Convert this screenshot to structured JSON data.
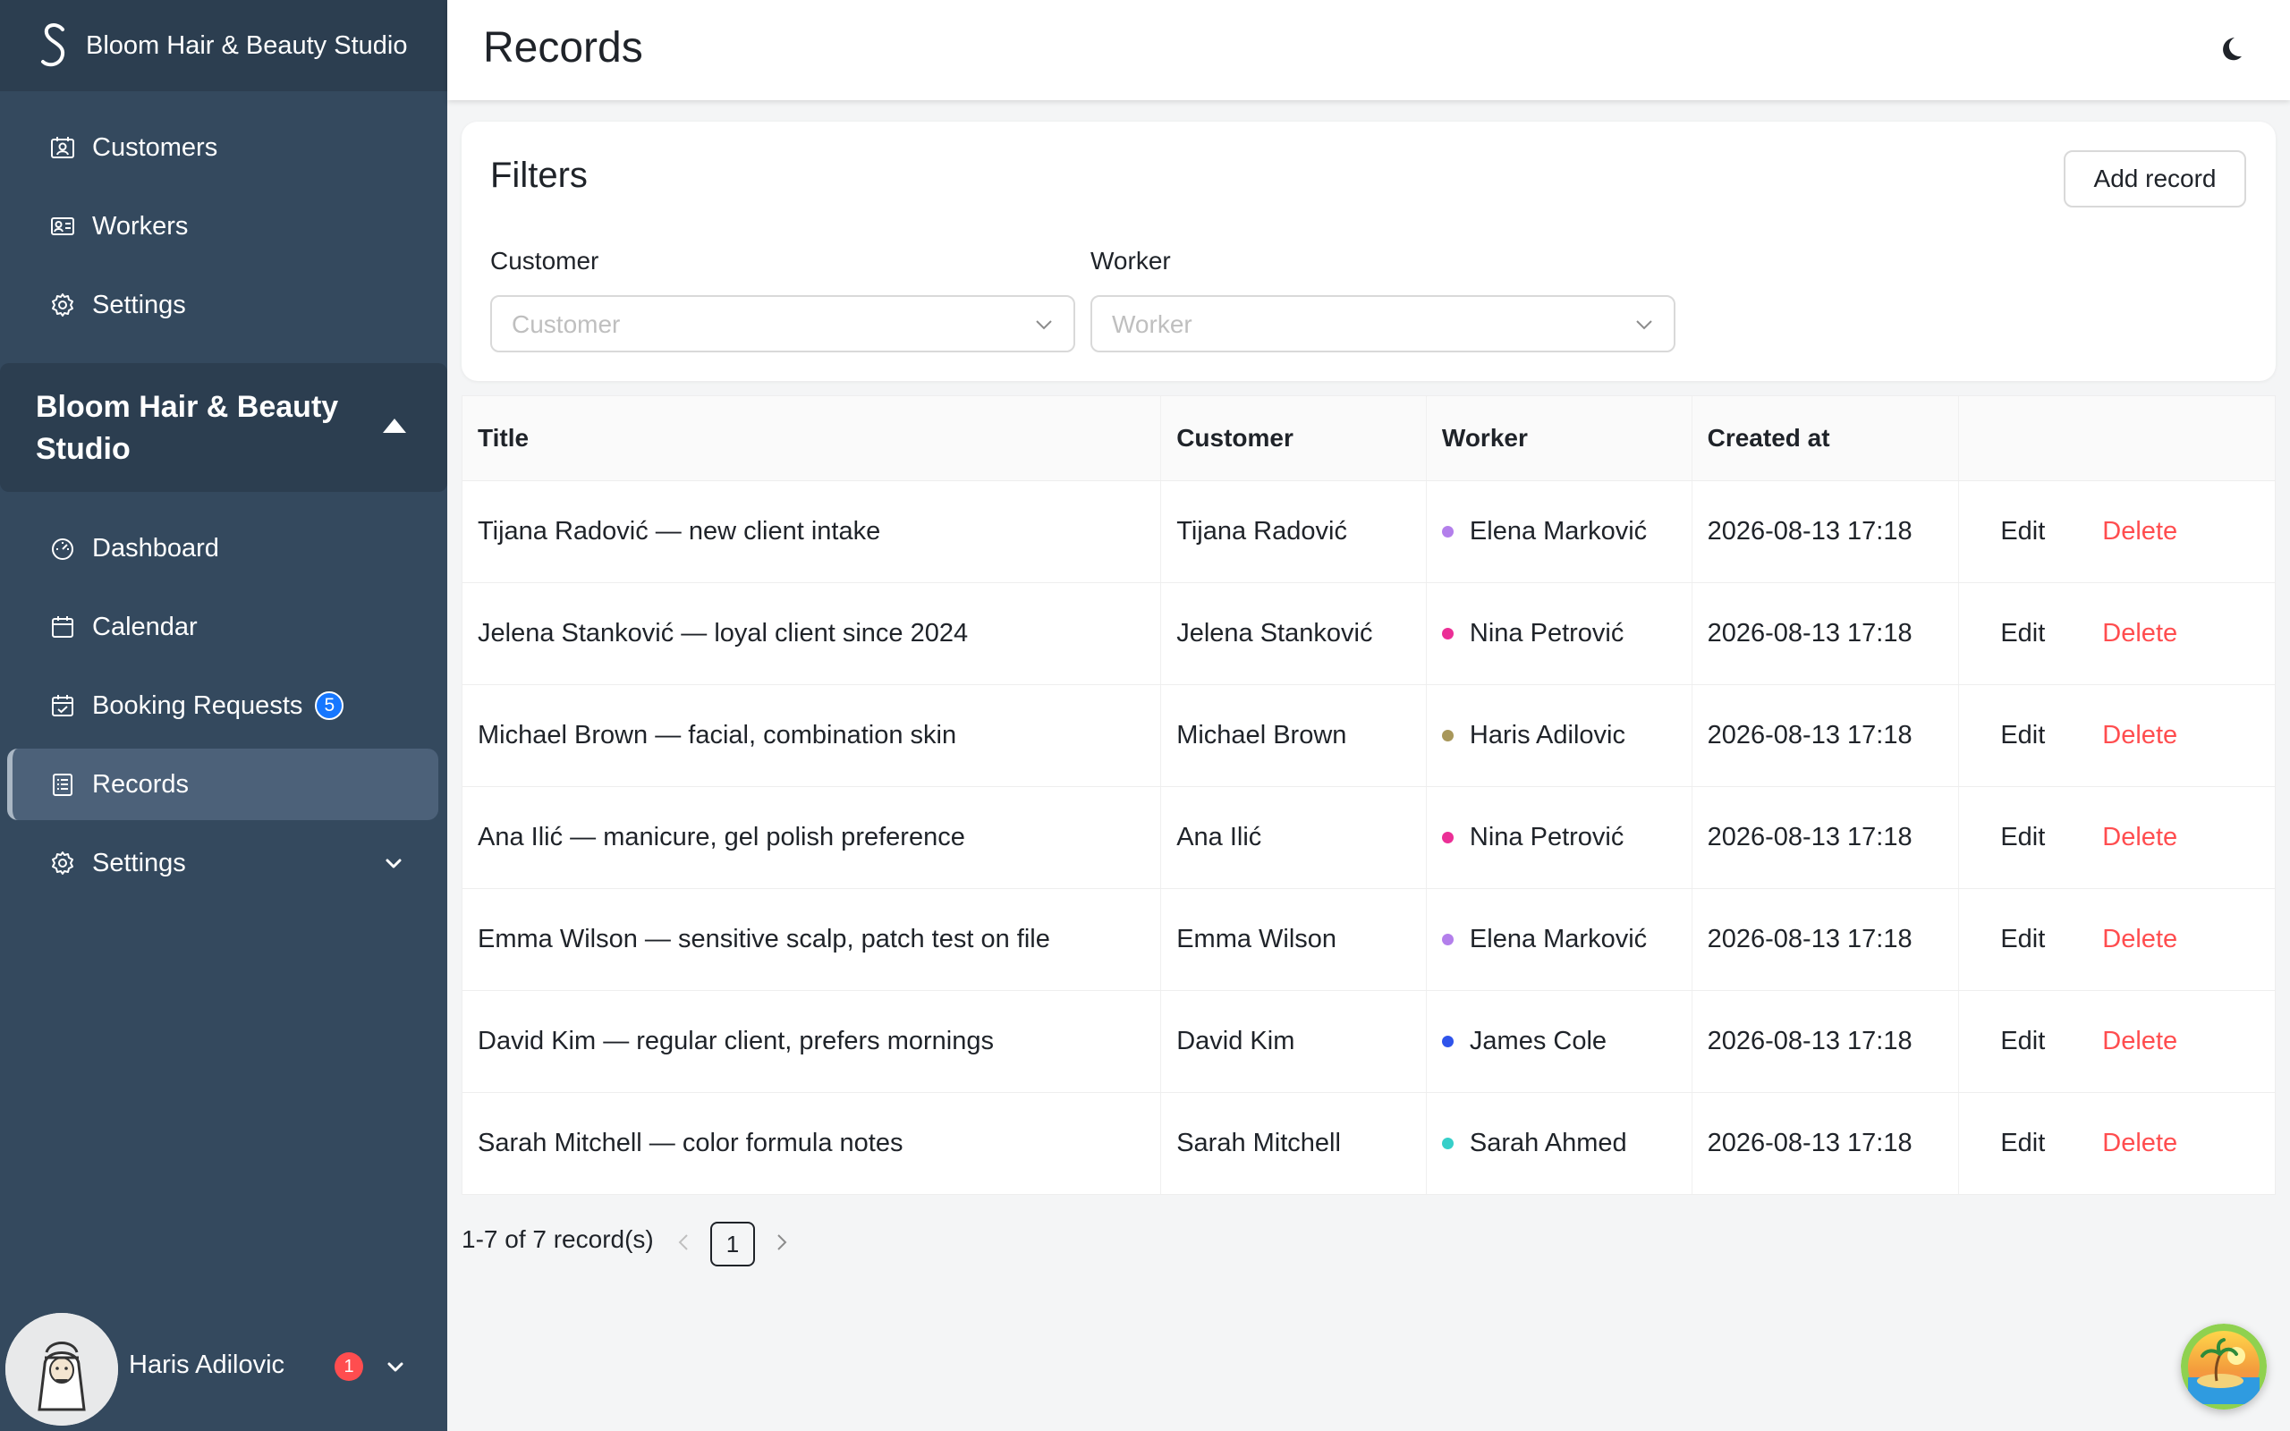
{
  "app": {
    "name": "Bloom Hair & Beauty Studio"
  },
  "sidebar": {
    "top_items": [
      {
        "label": "Customers",
        "icon": "customers-icon"
      },
      {
        "label": "Workers",
        "icon": "workers-icon"
      },
      {
        "label": "Settings",
        "icon": "gear-icon"
      }
    ],
    "group": {
      "title": "Bloom Hair & Beauty Studio"
    },
    "group_items": [
      {
        "label": "Dashboard",
        "icon": "dashboard-icon"
      },
      {
        "label": "Calendar",
        "icon": "calendar-icon"
      },
      {
        "label": "Booking Requests",
        "icon": "booking-icon",
        "badge": "5"
      },
      {
        "label": "Records",
        "icon": "records-icon",
        "active": true
      },
      {
        "label": "Settings",
        "icon": "gear-icon"
      }
    ],
    "user": {
      "name": "Haris Adilovic",
      "notifications": "1"
    }
  },
  "header": {
    "title": "Records"
  },
  "filters": {
    "title": "Filters",
    "add_button": "Add record",
    "customer": {
      "label": "Customer",
      "placeholder": "Customer"
    },
    "worker": {
      "label": "Worker",
      "placeholder": "Worker"
    }
  },
  "table": {
    "columns": [
      "Title",
      "Customer",
      "Worker",
      "Created at",
      ""
    ],
    "action_labels": {
      "edit": "Edit",
      "delete": "Delete"
    },
    "rows": [
      {
        "title": "Tijana Radović — new client intake",
        "customer": "Tijana Radović",
        "worker": "Elena Marković",
        "worker_color": "#b37feb",
        "created": "2026-08-13 17:18"
      },
      {
        "title": "Jelena Stanković — loyal client since 2024",
        "customer": "Jelena Stanković",
        "worker": "Nina Petrović",
        "worker_color": "#eb2f96",
        "created": "2026-08-13 17:18"
      },
      {
        "title": "Michael Brown — facial, combination skin",
        "customer": "Michael Brown",
        "worker": "Haris Adilovic",
        "worker_color": "#a8975a",
        "created": "2026-08-13 17:18"
      },
      {
        "title": "Ana Ilić — manicure, gel polish preference",
        "customer": "Ana Ilić",
        "worker": "Nina Petrović",
        "worker_color": "#eb2f96",
        "created": "2026-08-13 17:18"
      },
      {
        "title": "Emma Wilson — sensitive scalp, patch test on file",
        "customer": "Emma Wilson",
        "worker": "Elena Marković",
        "worker_color": "#b37feb",
        "created": "2026-08-13 17:18"
      },
      {
        "title": "David Kim — regular client, prefers mornings",
        "customer": "David Kim",
        "worker": "James Cole",
        "worker_color": "#2f54eb",
        "created": "2026-08-13 17:18"
      },
      {
        "title": "Sarah Mitchell — color formula notes",
        "customer": "Sarah Mitchell",
        "worker": "Sarah Ahmed",
        "worker_color": "#36cfc9",
        "created": "2026-08-13 17:18"
      }
    ]
  },
  "pagination": {
    "summary": "1-7 of 7 record(s)",
    "current_page": "1"
  },
  "colors": {
    "sidebar": "#34495e",
    "sidebar_dark": "#2c3e50",
    "danger": "#ff4d4f",
    "badge": "#1677ff"
  }
}
